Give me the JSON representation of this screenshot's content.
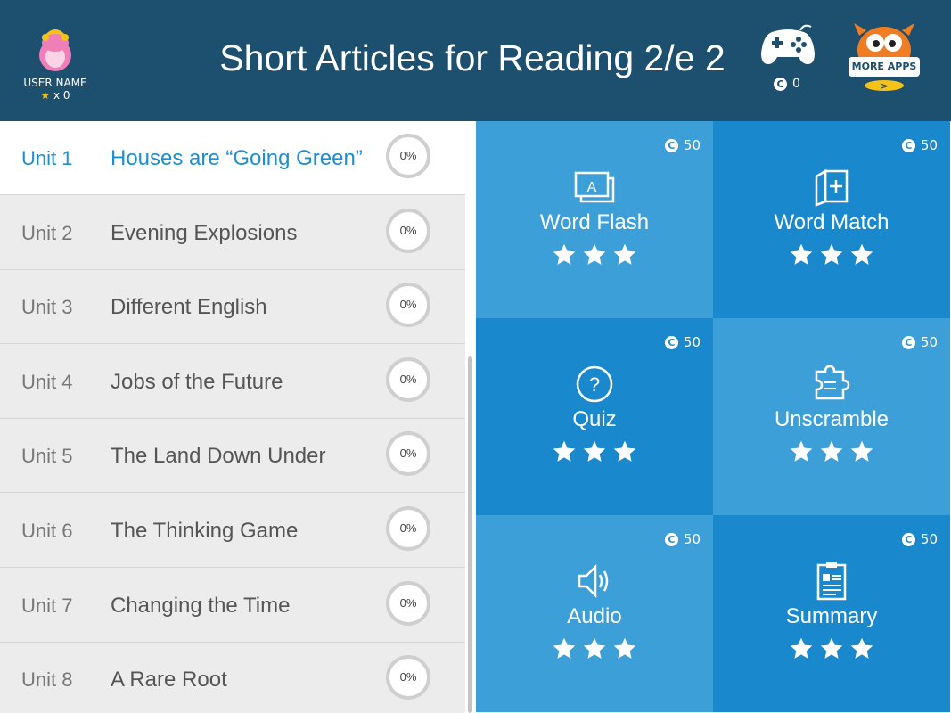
{
  "header": {
    "title": "Short Articles for Reading 2/e 2",
    "user_name": "USER NAME",
    "user_star_count": "x 0",
    "game_coins": "0",
    "more_apps": "MORE APPS >"
  },
  "units": [
    {
      "num": "Unit 1",
      "title": "Houses are “Going Green”",
      "progress": "0%"
    },
    {
      "num": "Unit 2",
      "title": "Evening Explosions",
      "progress": "0%"
    },
    {
      "num": "Unit 3",
      "title": "Different English",
      "progress": "0%"
    },
    {
      "num": "Unit 4",
      "title": "Jobs of the Future",
      "progress": "0%"
    },
    {
      "num": "Unit 5",
      "title": "The Land Down Under",
      "progress": "0%"
    },
    {
      "num": "Unit 6",
      "title": "The Thinking Game",
      "progress": "0%"
    },
    {
      "num": "Unit 7",
      "title": "Changing the Time",
      "progress": "0%"
    },
    {
      "num": "Unit 8",
      "title": "A Rare Root",
      "progress": "0%"
    }
  ],
  "activities": [
    {
      "label": "Word Flash",
      "cost": "50",
      "icon": "word-flash-icon",
      "stars": 3,
      "color": "#3d9fd8"
    },
    {
      "label": "Word Match",
      "cost": "50",
      "icon": "word-match-icon",
      "stars": 3,
      "color": "#1a88cc"
    },
    {
      "label": "Quiz",
      "cost": "50",
      "icon": "quiz-icon",
      "stars": 3,
      "color": "#1a88cc"
    },
    {
      "label": "Unscramble",
      "cost": "50",
      "icon": "unscramble-icon",
      "stars": 3,
      "color": "#3d9fd8"
    },
    {
      "label": "Audio",
      "cost": "50",
      "icon": "audio-icon",
      "stars": 3,
      "color": "#3d9fd8"
    },
    {
      "label": "Summary",
      "cost": "50",
      "icon": "summary-icon",
      "stars": 3,
      "color": "#1a88cc"
    }
  ],
  "colors": {
    "header_bg": "#1d4f6e",
    "active_unit": "#1b8fd2"
  }
}
